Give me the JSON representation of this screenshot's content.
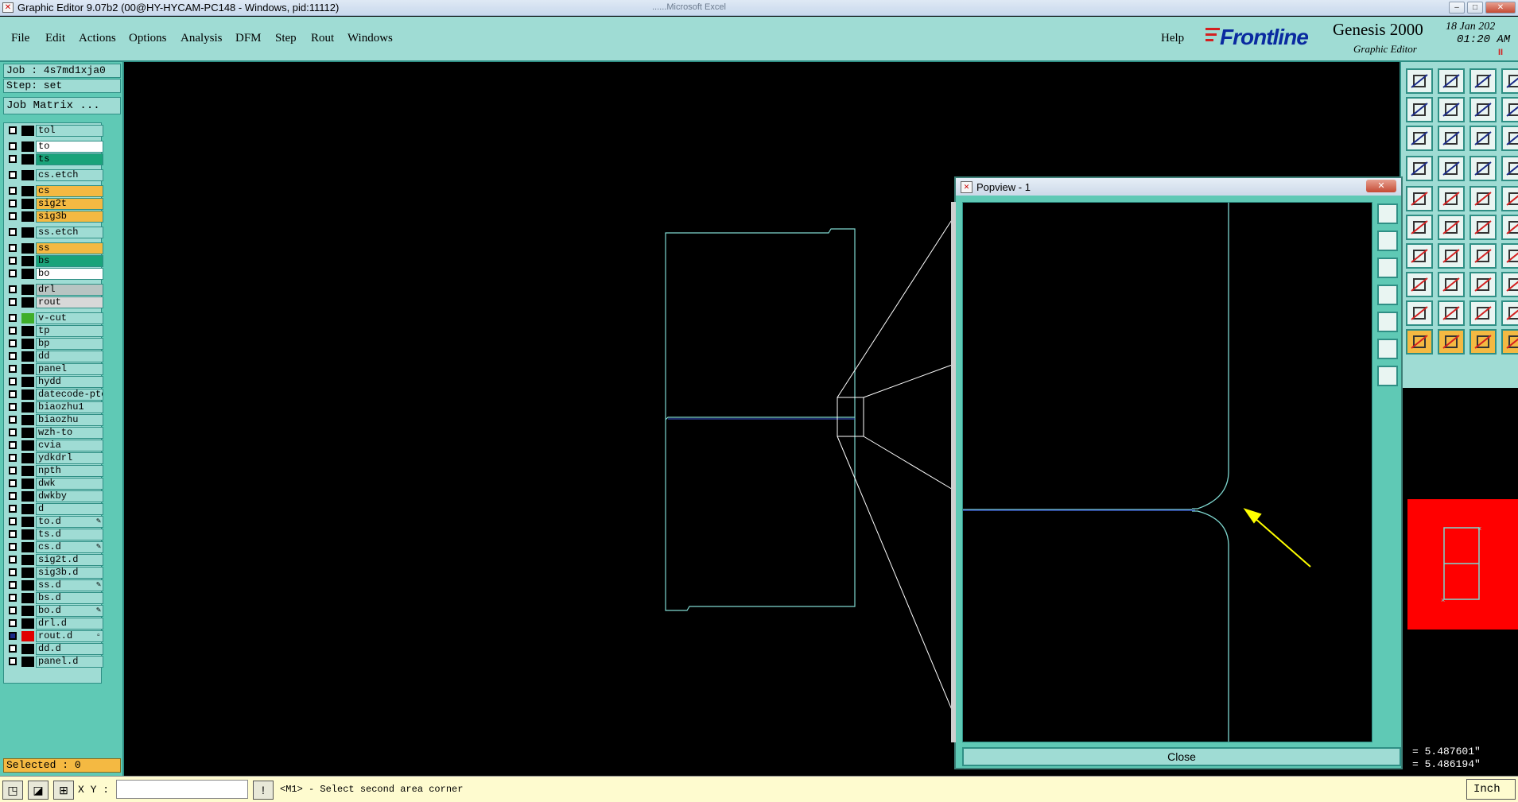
{
  "window": {
    "title": "Graphic Editor 9.07b2 (00@HY-HYCAM-PC148 - Windows, pid:11112)",
    "background_title": "......Microsoft Excel"
  },
  "menubar": {
    "items": [
      {
        "label": "File"
      },
      {
        "label": "Edit"
      },
      {
        "label": "Actions"
      },
      {
        "label": "Options"
      },
      {
        "label": "Analysis"
      },
      {
        "label": "DFM"
      },
      {
        "label": "Step"
      },
      {
        "label": "Rout"
      },
      {
        "label": "Windows"
      }
    ],
    "help_label": "Help"
  },
  "brand": {
    "logo_text": "Frontline",
    "product": "Genesis 2000",
    "subtitle": "Graphic Editor",
    "date": "18 Jan 202",
    "time": "01:20 AM",
    "pause_mark": "II"
  },
  "job": {
    "job_label": "Job : 4s7md1xja0",
    "step_label": "Step: set",
    "matrix_button": "Job Matrix ..."
  },
  "layers": [
    {
      "name": "tol",
      "bg": "#9fdcd4",
      "color": "#000000"
    },
    {
      "name": "to",
      "bg": "#ffffff",
      "color": "#000000"
    },
    {
      "name": "ts",
      "bg": "#1aa37a",
      "color": "#000000"
    },
    {
      "name": "cs.etch",
      "bg": "#9fdcd4",
      "color": "#000000"
    },
    {
      "name": "cs",
      "bg": "#f4b942",
      "color": "#000000"
    },
    {
      "name": "sig2t",
      "bg": "#f4b942",
      "color": "#000000"
    },
    {
      "name": "sig3b",
      "bg": "#f4b942",
      "color": "#000000"
    },
    {
      "name": "ss.etch",
      "bg": "#9fdcd4",
      "color": "#000000"
    },
    {
      "name": "ss",
      "bg": "#f4b942",
      "color": "#000000"
    },
    {
      "name": "bs",
      "bg": "#1aa37a",
      "color": "#000000"
    },
    {
      "name": "bo",
      "bg": "#ffffff",
      "color": "#000000"
    },
    {
      "name": "drl",
      "bg": "#b8c4c2",
      "color": "#000000"
    },
    {
      "name": "rout",
      "bg": "#d8d8d8",
      "color": "#000000"
    },
    {
      "name": "v-cut",
      "bg": "#9fdcd4",
      "color": "#3fae2a"
    },
    {
      "name": "tp",
      "bg": "#9fdcd4",
      "color": "#000000"
    },
    {
      "name": "bp",
      "bg": "#9fdcd4",
      "color": "#000000"
    },
    {
      "name": "dd",
      "bg": "#9fdcd4",
      "color": "#000000"
    },
    {
      "name": "panel",
      "bg": "#9fdcd4",
      "color": "#000000"
    },
    {
      "name": "hydd",
      "bg": "#9fdcd4",
      "color": "#000000"
    },
    {
      "name": "datecode-ptc",
      "bg": "#9fdcd4",
      "color": "#000000"
    },
    {
      "name": "biaozhu1",
      "bg": "#9fdcd4",
      "color": "#000000"
    },
    {
      "name": "biaozhu",
      "bg": "#9fdcd4",
      "color": "#000000"
    },
    {
      "name": "wzh-to",
      "bg": "#9fdcd4",
      "color": "#000000"
    },
    {
      "name": "cvia",
      "bg": "#9fdcd4",
      "color": "#000000"
    },
    {
      "name": "ydkdrl",
      "bg": "#9fdcd4",
      "color": "#000000"
    },
    {
      "name": "npth",
      "bg": "#9fdcd4",
      "color": "#000000"
    },
    {
      "name": "dwk",
      "bg": "#9fdcd4",
      "color": "#000000"
    },
    {
      "name": "dwkby",
      "bg": "#9fdcd4",
      "color": "#000000"
    },
    {
      "name": "d",
      "bg": "#9fdcd4",
      "color": "#000000"
    },
    {
      "name": "to.d",
      "bg": "#9fdcd4",
      "color": "#000000",
      "mark": "✎"
    },
    {
      "name": "ts.d",
      "bg": "#9fdcd4",
      "color": "#000000"
    },
    {
      "name": "cs.d",
      "bg": "#9fdcd4",
      "color": "#000000",
      "mark": "✎"
    },
    {
      "name": "sig2t.d",
      "bg": "#9fdcd4",
      "color": "#000000"
    },
    {
      "name": "sig3b.d",
      "bg": "#9fdcd4",
      "color": "#000000"
    },
    {
      "name": "ss.d",
      "bg": "#9fdcd4",
      "color": "#000000",
      "mark": "✎"
    },
    {
      "name": "bs.d",
      "bg": "#9fdcd4",
      "color": "#000000"
    },
    {
      "name": "bo.d",
      "bg": "#9fdcd4",
      "color": "#000000",
      "mark": "✎"
    },
    {
      "name": "drl.d",
      "bg": "#9fdcd4",
      "color": "#000000"
    },
    {
      "name": "rout.d",
      "bg": "#9fdcd4",
      "color": "#e00000",
      "mark": "▫",
      "active": true
    },
    {
      "name": "dd.d",
      "bg": "#9fdcd4",
      "color": "#000000"
    },
    {
      "name": "panel.d",
      "bg": "#9fdcd4",
      "color": "#000000"
    }
  ],
  "selected_label": "Selected : 0",
  "popview": {
    "title": "Popview - 1",
    "close_label": "Close"
  },
  "readout": {
    "x": "= 5.487601\"",
    "y": "= 5.486194\""
  },
  "statusbar": {
    "xy_label": "X Y :",
    "xy_value": "",
    "message": "<M1> - Select second area corner",
    "units": "Inch"
  },
  "colors": {
    "panel": "#9fdcd4",
    "panel_dark": "#5fc9b5",
    "outline": "#7fd8d0",
    "highlight_arrow": "#ffff00",
    "active_layer": "#e00000"
  }
}
